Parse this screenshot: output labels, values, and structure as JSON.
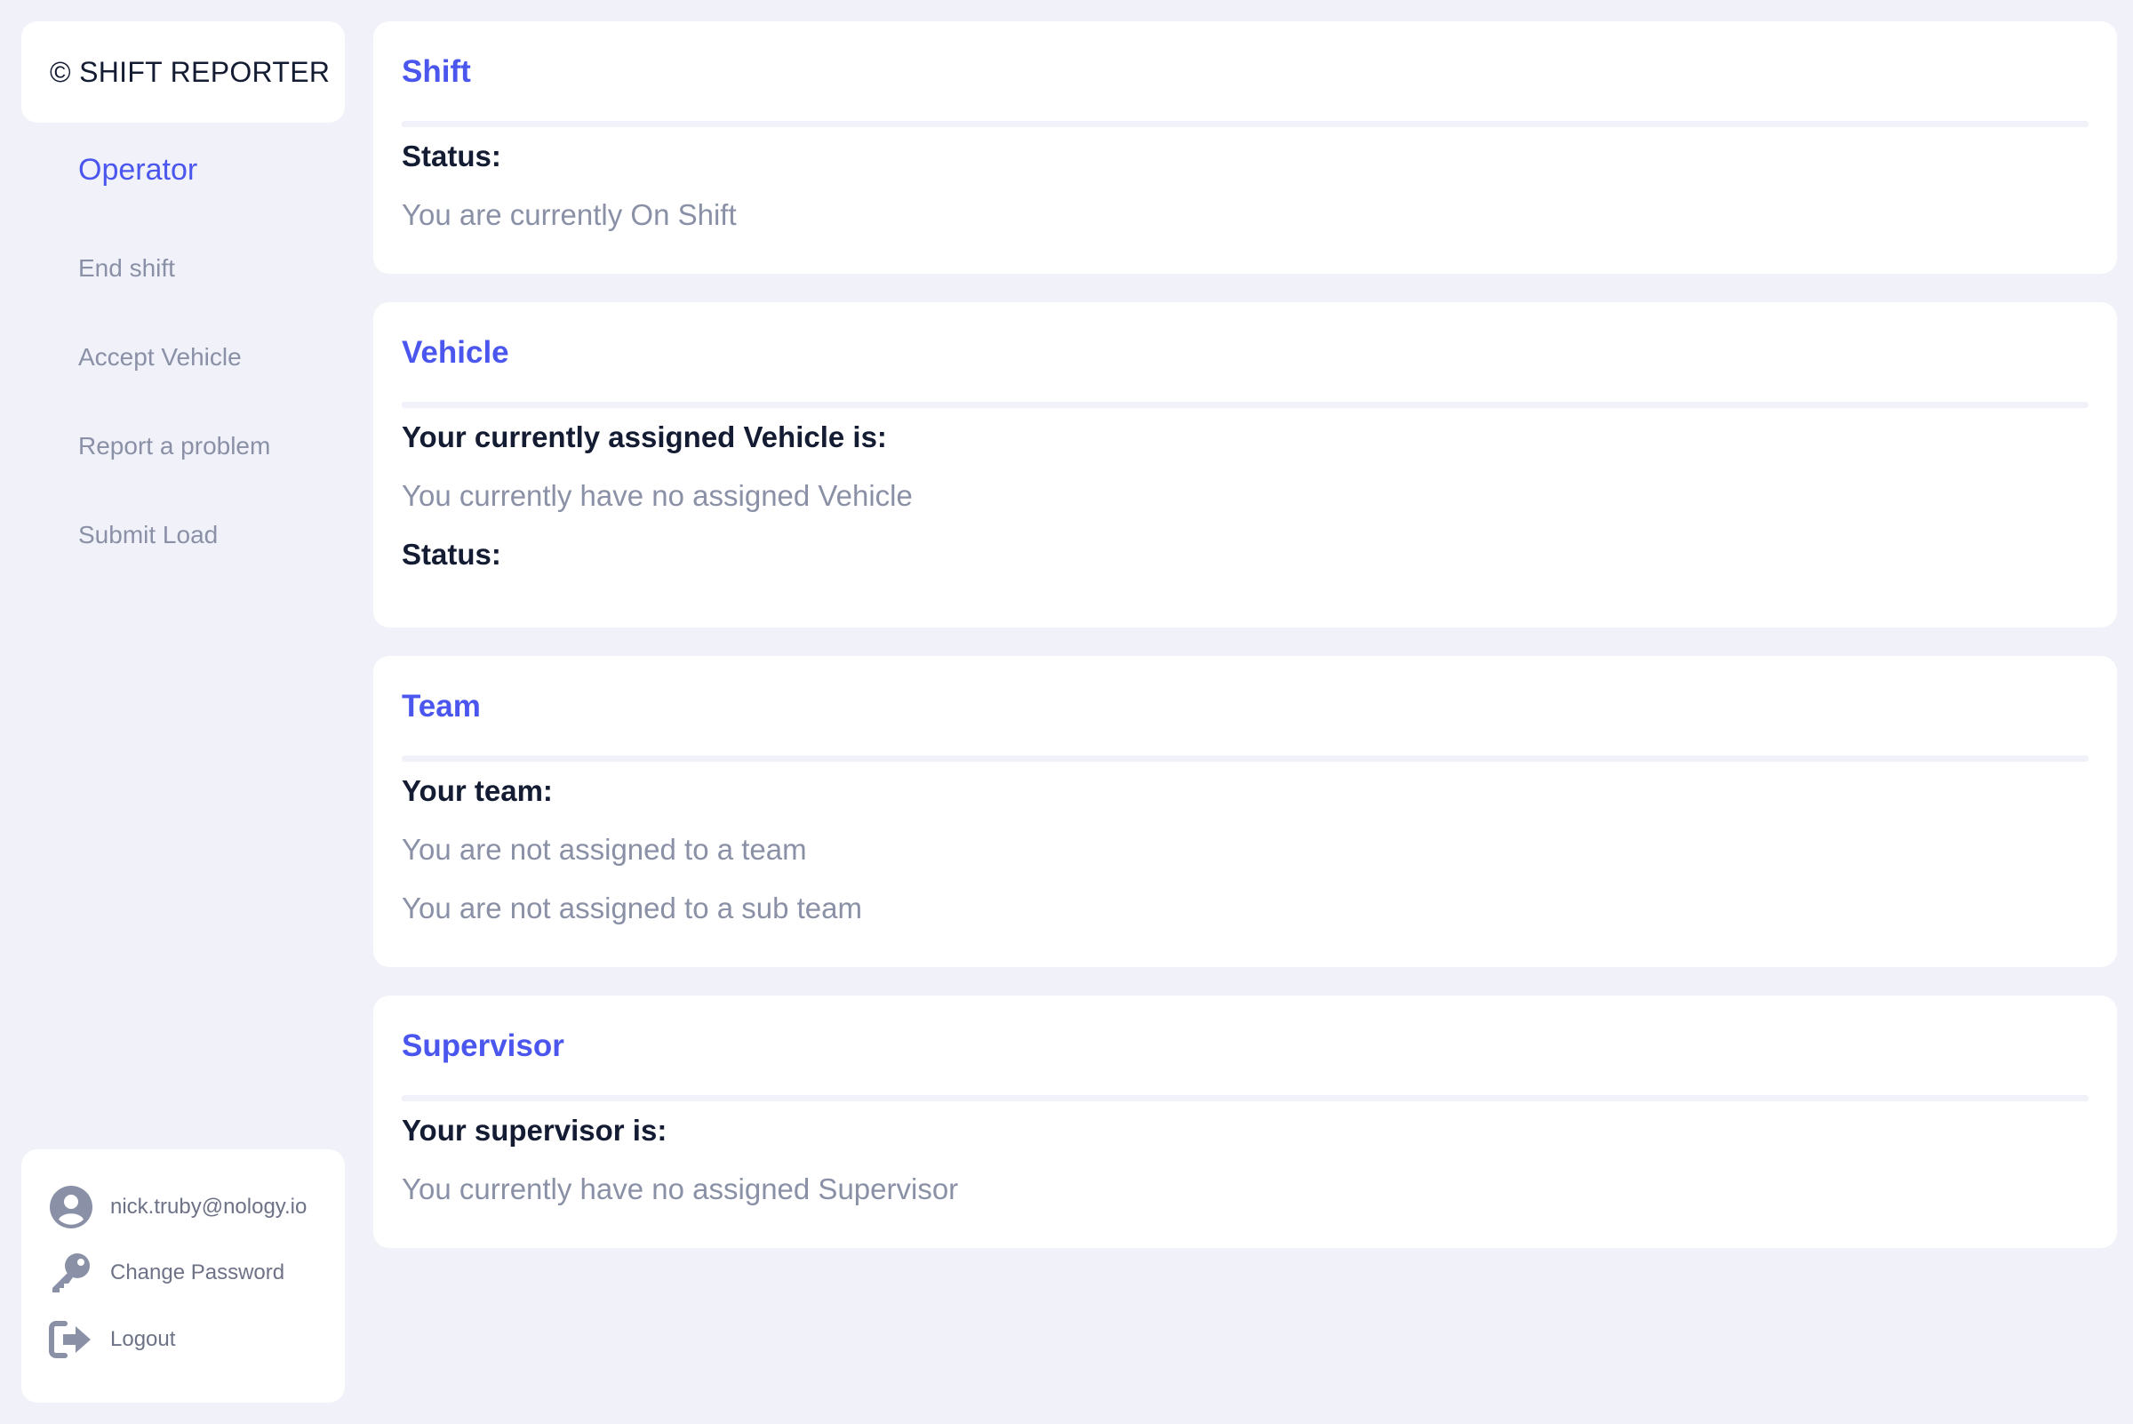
{
  "brand": {
    "copyright_symbol": "©",
    "title": "SHIFT REPORTER"
  },
  "sidebar": {
    "heading": "Operator",
    "items": [
      {
        "label": "End shift"
      },
      {
        "label": "Accept Vehicle"
      },
      {
        "label": "Report a problem"
      },
      {
        "label": "Submit Load"
      }
    ]
  },
  "user_menu": {
    "email": "nick.truby@nology.io",
    "change_password": "Change Password",
    "logout": "Logout",
    "icons": [
      "user-circle-icon",
      "key-icon",
      "logout-icon"
    ]
  },
  "cards": {
    "shift": {
      "title": "Shift",
      "status_label": "Status:",
      "status_value": "You are currently On Shift"
    },
    "vehicle": {
      "title": "Vehicle",
      "assigned_label": "Your currently assigned Vehicle is:",
      "assigned_value": "You currently have no assigned Vehicle",
      "status_label": "Status:"
    },
    "team": {
      "title": "Team",
      "team_label": "Your team:",
      "team_value": "You are not assigned to a team",
      "sub_team_value": "You are not assigned to a sub team"
    },
    "supervisor": {
      "title": "Supervisor",
      "supervisor_label": "Your supervisor is:",
      "supervisor_value": "You currently have no assigned Supervisor"
    }
  },
  "colors": {
    "background": "#f0f1f9",
    "card": "#ffffff",
    "accent": "#4a56ee",
    "text_dark": "#141c33",
    "text_muted": "#8a90a6"
  }
}
